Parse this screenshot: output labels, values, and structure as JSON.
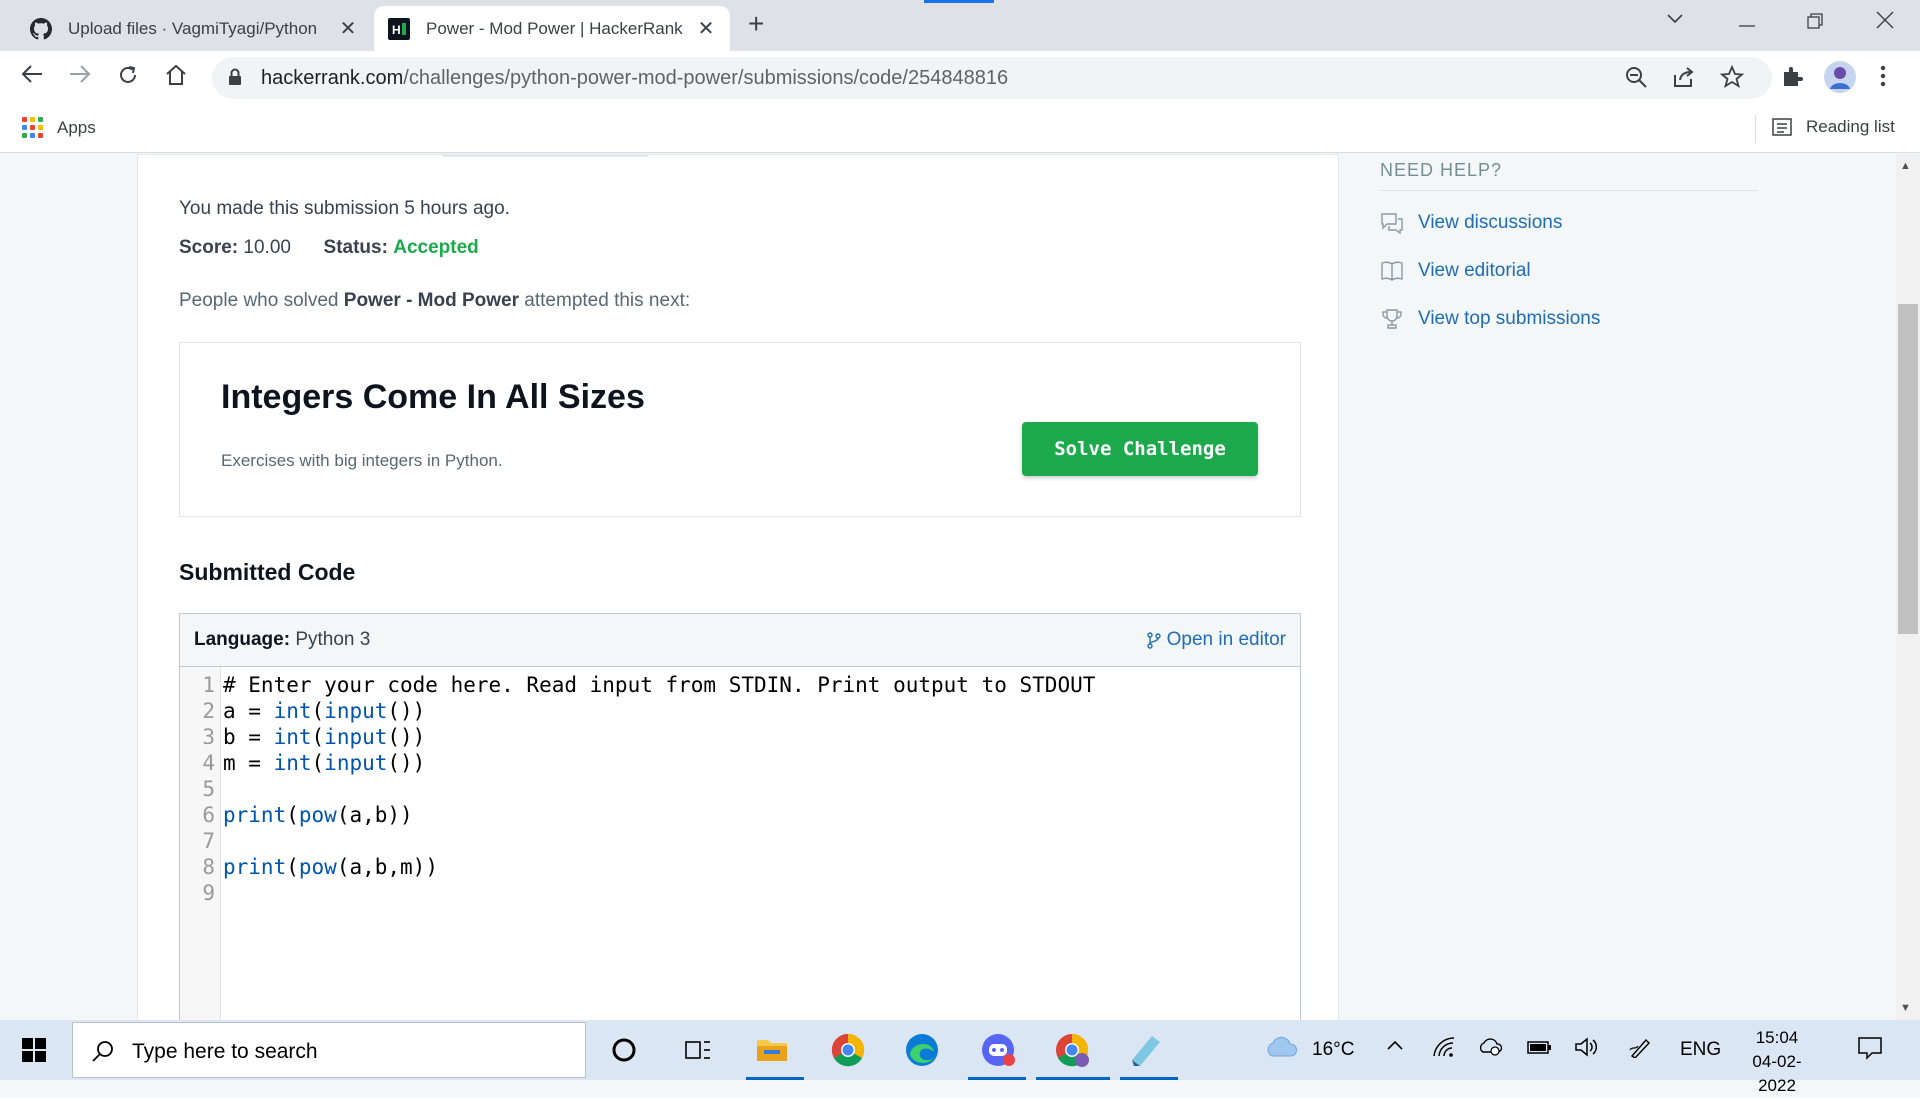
{
  "browser": {
    "tabs": [
      {
        "title": "Upload files · VagmiTyagi/Python",
        "active": false
      },
      {
        "title": "Power - Mod Power | HackerRank",
        "active": true
      }
    ],
    "url_host": "hackerrank.com",
    "url_path": "/challenges/python-power-mod-power/submissions/code/254848816",
    "bookmarks": {
      "apps": "Apps",
      "reading_list": "Reading list"
    }
  },
  "submission": {
    "made_text": "You made this submission 5 hours ago.",
    "score_label": "Score:",
    "score_value": "10.00",
    "status_label": "Status:",
    "status_value": "Accepted",
    "people_prefix": "People who solved ",
    "people_challenge": "Power - Mod Power",
    "people_suffix": " attempted this next:"
  },
  "next_challenge": {
    "title": "Integers Come In All Sizes",
    "description": "Exercises with big integers in Python.",
    "button": "Solve Challenge"
  },
  "submitted_code": {
    "heading": "Submitted Code",
    "language_label": "Language:",
    "language_value": "Python 3",
    "open_editor": "Open in editor",
    "lines": [
      {
        "n": "1",
        "text": "# Enter your code here. Read input from STDIN. Print output to STDOUT"
      },
      {
        "n": "2",
        "text": "a = int(input())"
      },
      {
        "n": "3",
        "text": "b = int(input())"
      },
      {
        "n": "4",
        "text": "m = int(input())"
      },
      {
        "n": "5",
        "text": ""
      },
      {
        "n": "6",
        "text": "print(pow(a,b))"
      },
      {
        "n": "7",
        "text": ""
      },
      {
        "n": "8",
        "text": "print(pow(a,b,m))"
      },
      {
        "n": "9",
        "text": ""
      }
    ]
  },
  "sidebar": {
    "title": "NEED HELP?",
    "links": [
      {
        "label": "View discussions",
        "icon": "discussion-icon"
      },
      {
        "label": "View editorial",
        "icon": "book-icon"
      },
      {
        "label": "View top submissions",
        "icon": "trophy-icon"
      }
    ]
  },
  "taskbar": {
    "search_placeholder": "Type here to search",
    "weather": "16°C",
    "language": "ENG",
    "time": "15:04",
    "date": "04-02-2022"
  },
  "colors": {
    "accent_green": "#1ba94c",
    "link_blue": "#1f6bb5"
  }
}
